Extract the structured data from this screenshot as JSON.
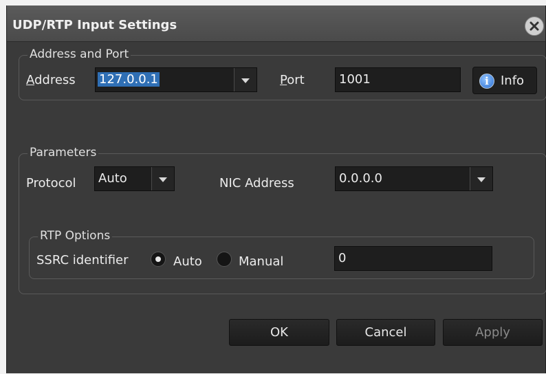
{
  "window": {
    "title": "UDP/RTP Input Settings"
  },
  "address_port": {
    "group_label": "Address and Port",
    "address_label_underline": "A",
    "address_label_rest": "ddress",
    "address_value": "127.0.0.1",
    "port_label_underline": "P",
    "port_label_rest": "ort",
    "port_value": "1001",
    "info_label": "Info"
  },
  "parameters": {
    "group_label": "Parameters",
    "protocol_label": "Protocol",
    "protocol_value": "Auto",
    "nic_label": "NIC Address",
    "nic_value": "0.0.0.0"
  },
  "rtp_options": {
    "group_label": "RTP Options",
    "ssrc_label": "SSRC identifier",
    "radio_auto": "Auto",
    "radio_manual": "Manual",
    "ssrc_value": "0",
    "selected": "Auto"
  },
  "buttons": {
    "ok": "OK",
    "cancel": "Cancel",
    "apply": "Apply"
  },
  "icons": {
    "close": "close-icon",
    "info": "info-icon",
    "dropdown": "chevron-down-icon"
  }
}
